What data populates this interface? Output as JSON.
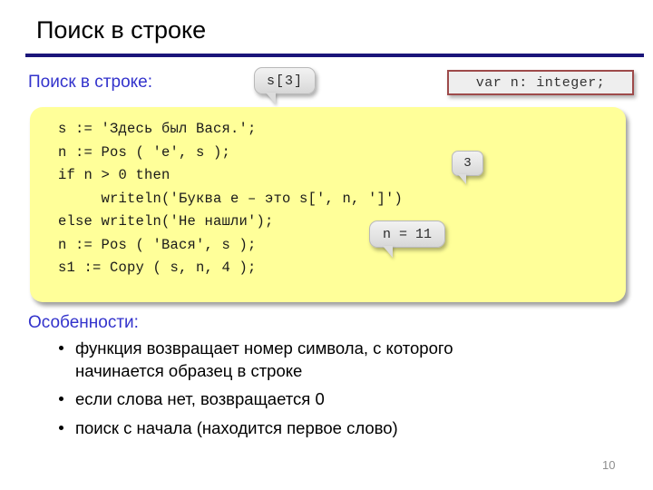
{
  "slide": {
    "title": "Поиск в строке",
    "page_number": "10",
    "rule_color": "#1b157a",
    "accent_color": "#3333cc"
  },
  "subtitle": {
    "text": "Поиск в строке:"
  },
  "callouts": {
    "index_expr": "s[3]",
    "result_3": "3",
    "result_n": "n = 11"
  },
  "var_declaration": {
    "text": "var n: integer;",
    "border_color": "#9e4b4b"
  },
  "code": {
    "background_color": "#ffff99",
    "lines": [
      "s := 'Здесь был Вася.';",
      "n := Pos ( 'e', s );",
      "if n > 0 then",
      "     writeln('Буква е – это s[', n, ']')",
      "else writeln('Не нашли');",
      "n := Pos ( 'Вася', s );",
      "s1 := Copy ( s, n, 4 );"
    ]
  },
  "features": {
    "heading": "Особенности:",
    "items": [
      {
        "line1": "функция возвращает номер символа, с которого",
        "line2": "начинается образец в строке"
      },
      {
        "line1": "если слова нет, возвращается 0",
        "line2": ""
      },
      {
        "line1": "поиск с начала (находится первое слово)",
        "line2": ""
      }
    ]
  }
}
